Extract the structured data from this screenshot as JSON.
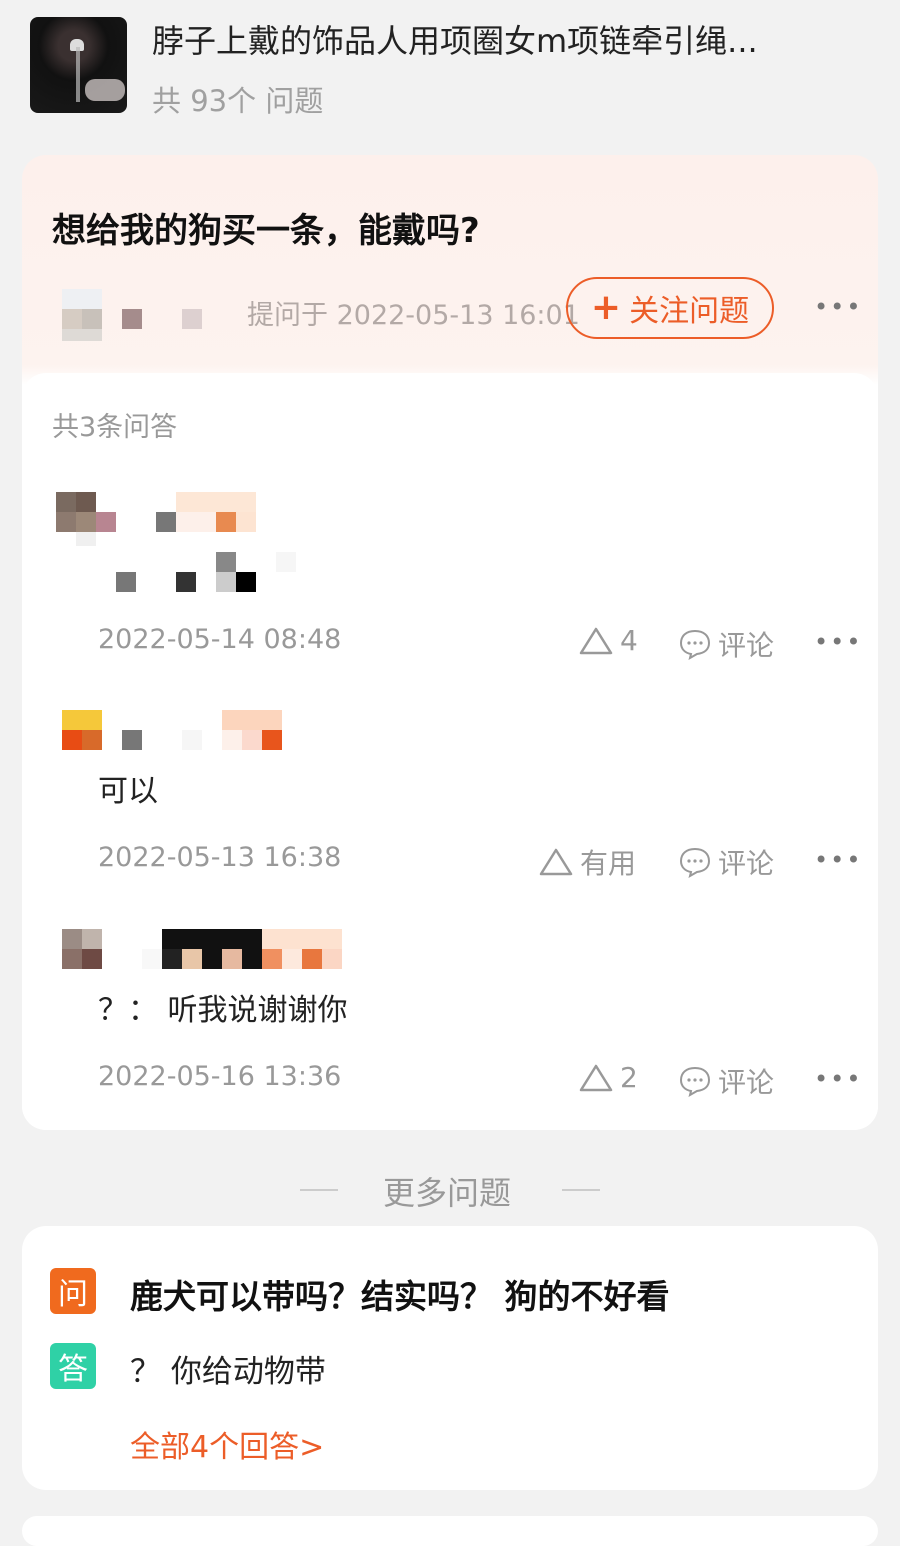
{
  "product": {
    "title": "脖子上戴的饰品人用项圈女m项链牵引绳...",
    "question_count": "共 93个 问题",
    "thumbnail_icon": "product-thumbnail"
  },
  "question": {
    "title": "想给我的狗买一条，能戴吗?",
    "asked_time": "提问于 2022-05-13 16:01",
    "follow_button": "关注问题",
    "follow_icon": "plus-icon",
    "accent_color": "#ec5d28"
  },
  "answers": {
    "count_label": "共3条问答",
    "items": [
      {
        "text": "",
        "time": "2022-05-14 08:48",
        "like": "4",
        "comment": "评论"
      },
      {
        "text": "可以",
        "time": "2022-05-13 16:38",
        "like": "有用",
        "comment": "评论"
      },
      {
        "text": "？： 听我说谢谢你",
        "time": "2022-05-16 13:36",
        "like": "2",
        "comment": "评论"
      }
    ]
  },
  "more_questions": {
    "label": "更多问题",
    "item": {
      "q_badge": "问",
      "a_badge": "答",
      "question": "鹿犬可以带吗？结实吗？ 狗的不好看",
      "answer": "？ 你给动物带",
      "link": "全部4个回答>"
    }
  }
}
